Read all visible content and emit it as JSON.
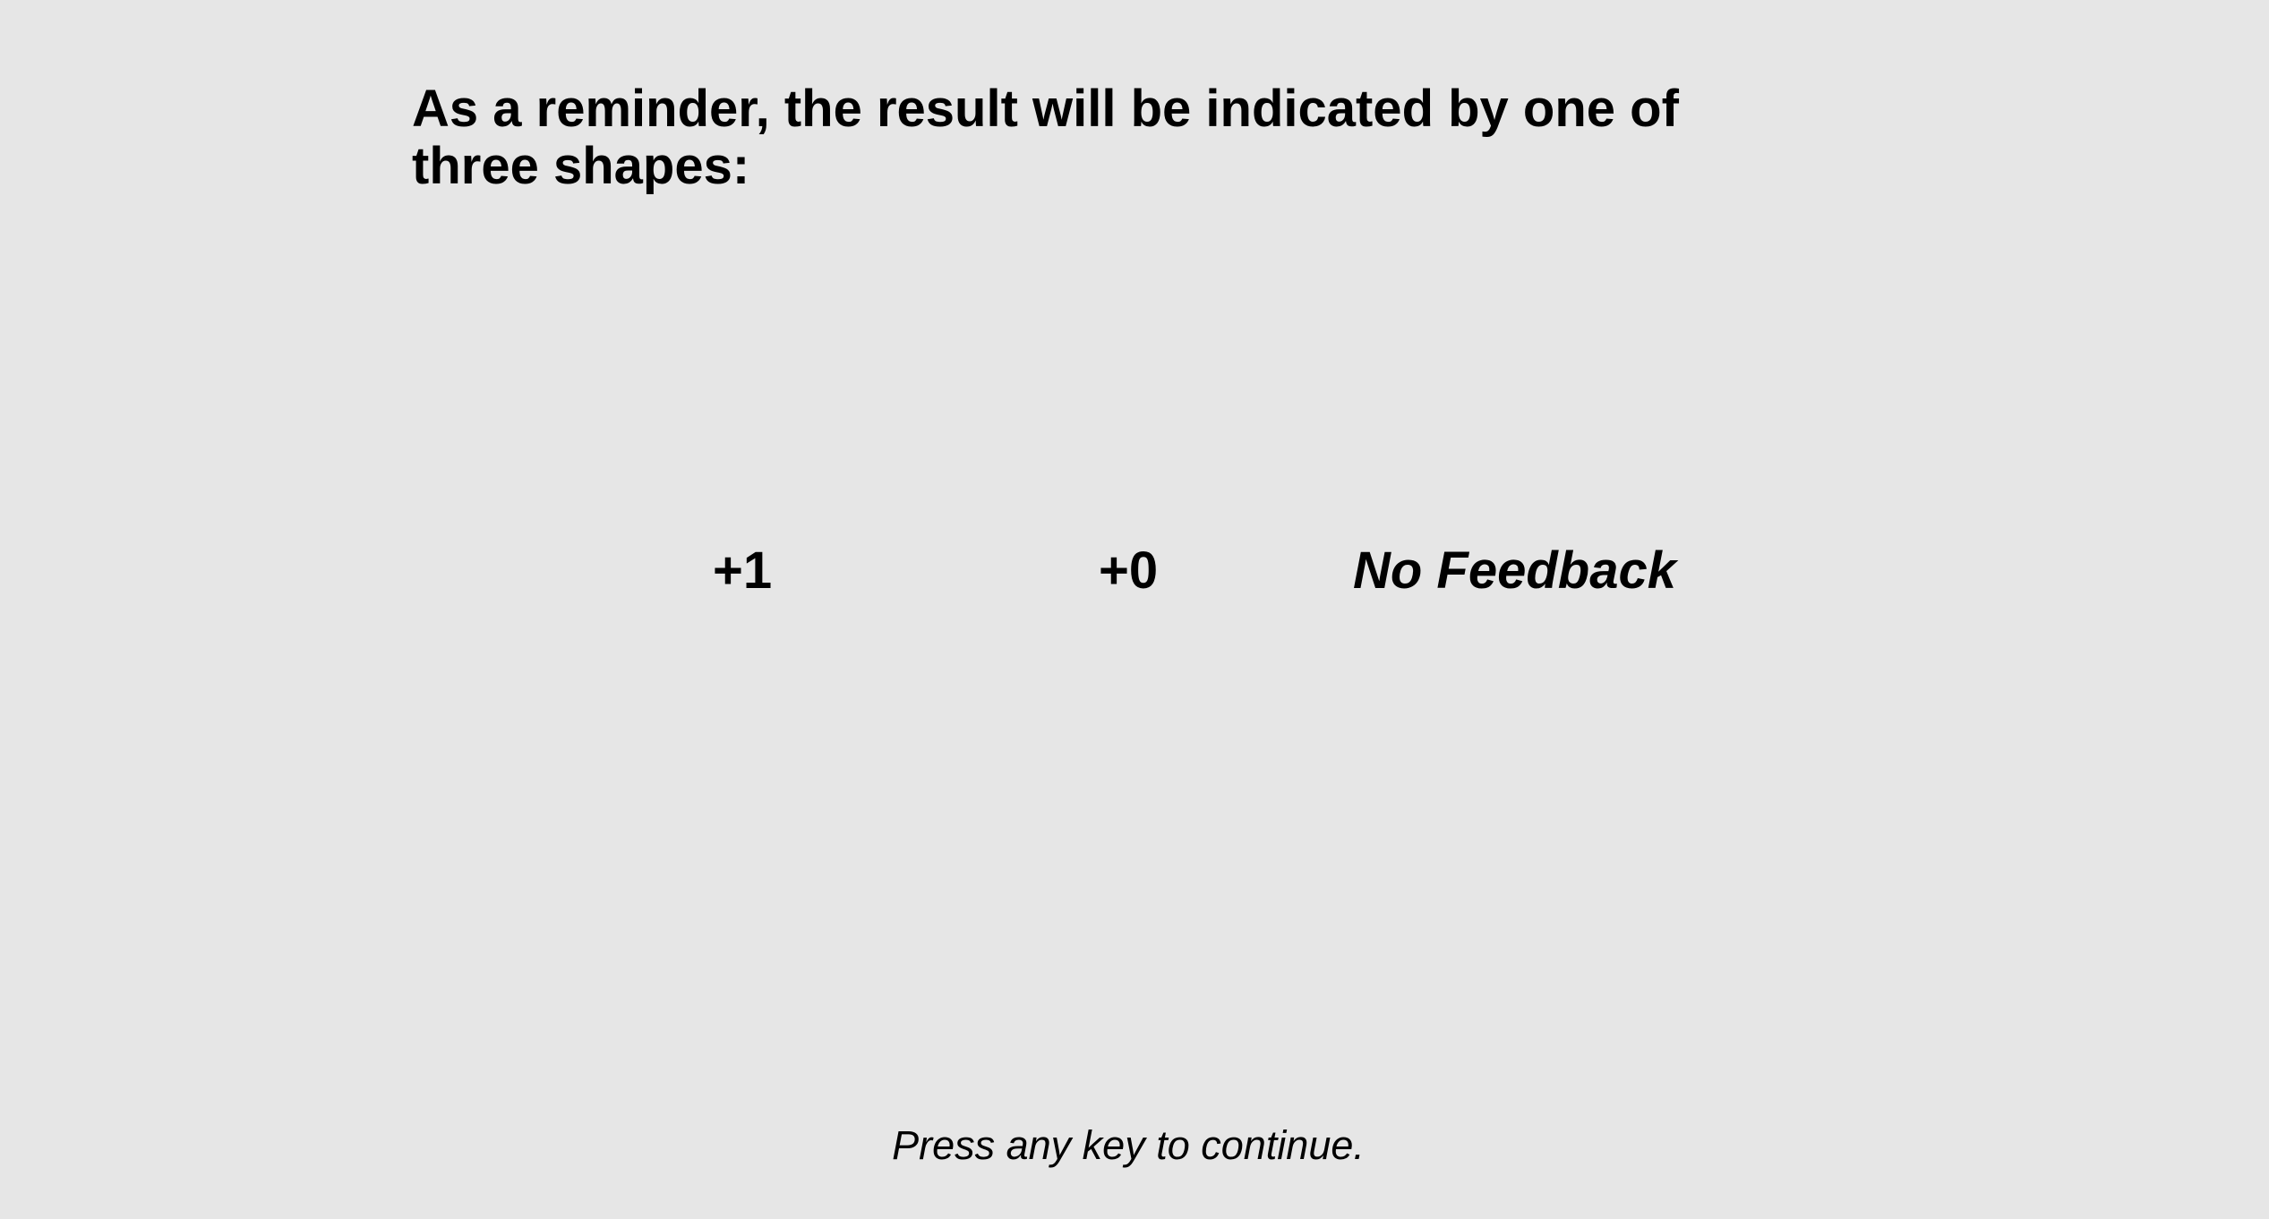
{
  "instructions": {
    "heading": "As a reminder, the result will be indicated by one of three shapes:",
    "outcomes": [
      {
        "label": "+1"
      },
      {
        "label": "+0"
      },
      {
        "label": "No Feedback"
      }
    ],
    "continue_prompt": "Press any key to continue."
  },
  "colors": {
    "background": "#e6e6e6",
    "text": "#000000"
  }
}
